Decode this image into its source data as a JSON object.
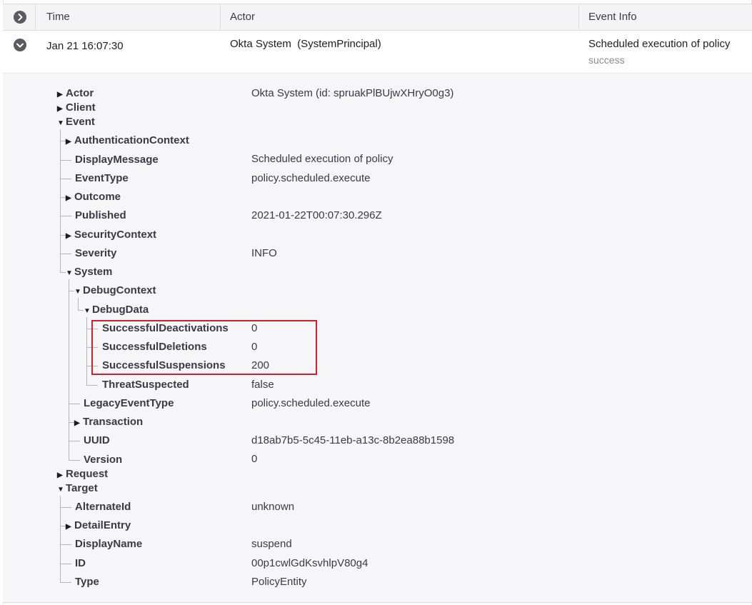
{
  "table": {
    "headers": {
      "time": "Time",
      "actor": "Actor",
      "event_info": "Event Info"
    },
    "row": {
      "time": "Jan 21 16:07:30",
      "actor": "Okta System  (SystemPrincipal)",
      "event_info": "Scheduled execution of policy",
      "event_status": "success"
    }
  },
  "tree": {
    "actor": {
      "label": "Actor",
      "value": "Okta System (id: spruakPlBUjwXHryO0g3)"
    },
    "client": {
      "label": "Client"
    },
    "event": {
      "label": "Event",
      "authentication_context": {
        "label": "AuthenticationContext"
      },
      "display_message": {
        "label": "DisplayMessage",
        "value": "Scheduled execution of policy"
      },
      "event_type": {
        "label": "EventType",
        "value": "policy.scheduled.execute"
      },
      "outcome": {
        "label": "Outcome"
      },
      "published": {
        "label": "Published",
        "value": "2021-01-22T00:07:30.296Z"
      },
      "security_context": {
        "label": "SecurityContext"
      },
      "severity": {
        "label": "Severity",
        "value": "INFO"
      },
      "system": {
        "label": "System",
        "debug_context": {
          "label": "DebugContext",
          "debug_data": {
            "label": "DebugData",
            "successful_deactivations": {
              "label": "SuccessfulDeactivations",
              "value": "0"
            },
            "successful_deletions": {
              "label": "SuccessfulDeletions",
              "value": "0"
            },
            "successful_suspensions": {
              "label": "SuccessfulSuspensions",
              "value": "200"
            },
            "threat_suspected": {
              "label": "ThreatSuspected",
              "value": "false"
            }
          }
        },
        "legacy_event_type": {
          "label": "LegacyEventType",
          "value": "policy.scheduled.execute"
        },
        "transaction": {
          "label": "Transaction"
        },
        "uuid": {
          "label": "UUID",
          "value": "d18ab7b5-5c45-11eb-a13c-8b2ea88b1598"
        },
        "version": {
          "label": "Version",
          "value": "0"
        }
      }
    },
    "request": {
      "label": "Request"
    },
    "target": {
      "label": "Target",
      "alternate_id": {
        "label": "AlternateId",
        "value": "unknown"
      },
      "detail_entry": {
        "label": "DetailEntry"
      },
      "display_name": {
        "label": "DisplayName",
        "value": "suspend"
      },
      "id": {
        "label": "ID",
        "value": "00p1cwlGdKsvhlpV80g4"
      },
      "type": {
        "label": "Type",
        "value": "PolicyEntity"
      }
    }
  },
  "highlight_color": "#d0202c"
}
